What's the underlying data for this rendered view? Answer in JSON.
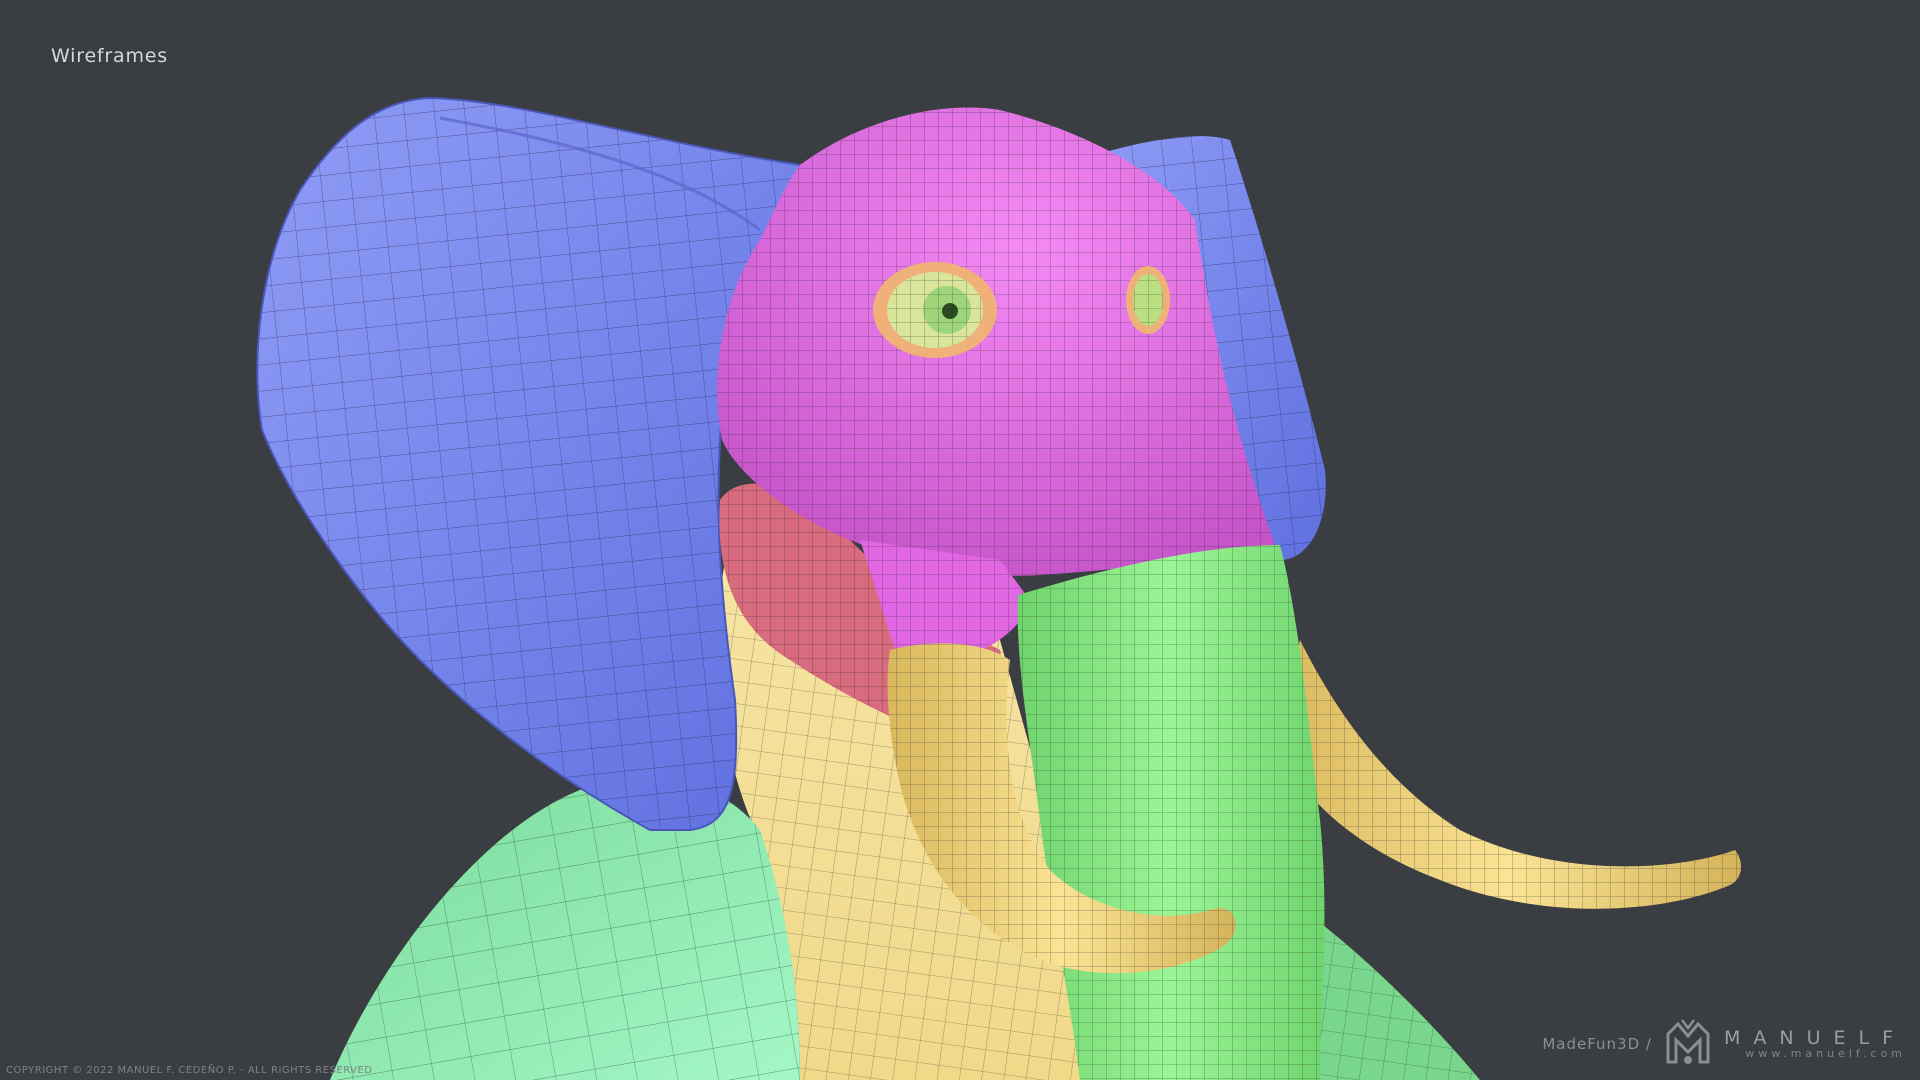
{
  "header": {
    "title": "Wireframes"
  },
  "footer": {
    "copyright": "COPYRIGHT © 2022 MANUEL F. CEDEÑO P. - ALL RIGHTS RESERVED",
    "made": "MadeFun3D /",
    "wordmark": "MANUELF",
    "url": "www.manuelf.com"
  },
  "render": {
    "subject": "elephant-wireframe-render",
    "colors": {
      "background": "#3a3d41",
      "ears": "#7c8cf2",
      "head": "#e66ee8",
      "trunk": "#8af083",
      "tusks": "#f2d57a",
      "body": "#f5e19a",
      "shoulder": "#86e3a6",
      "cheek": "#d96a7c",
      "eye": "#c6e08a"
    }
  }
}
